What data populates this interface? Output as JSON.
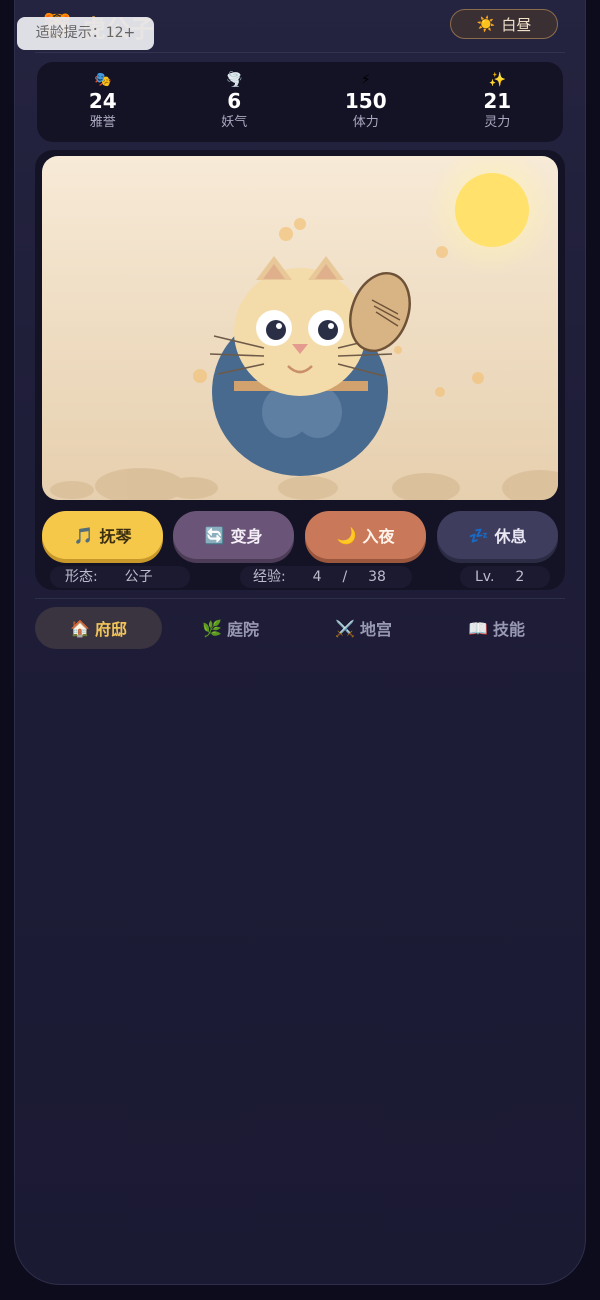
{
  "age_notice": "适龄提示：12+",
  "header": {
    "logo_icon": "🐯",
    "title": "虎公子",
    "time_toggle": {
      "icon": "☀️",
      "label": "白昼"
    }
  },
  "stats": [
    {
      "icon": "🎭",
      "value": "24",
      "label": "雅誉"
    },
    {
      "icon": "🌪️",
      "value": "6",
      "label": "妖气"
    },
    {
      "icon": "⚡",
      "value": "150",
      "label": "体力"
    },
    {
      "icon": "✨",
      "value": "21",
      "label": "灵力"
    }
  ],
  "actions": [
    {
      "icon": "🎵",
      "label": "抚琴"
    },
    {
      "icon": "🔄",
      "label": "变身"
    },
    {
      "icon": "🌙",
      "label": "入夜"
    },
    {
      "icon": "💤",
      "label": "休息"
    }
  ],
  "status": {
    "form_label": "形态:",
    "form_value": "公子",
    "exp_label": "经验:",
    "exp_current": "4",
    "exp_sep": "/",
    "exp_max": "38",
    "level_label": "Lv.",
    "level_value": "2"
  },
  "tabs": [
    {
      "icon": "🏠",
      "label": "府邸",
      "active": true
    },
    {
      "icon": "🌿",
      "label": "庭院",
      "active": false
    },
    {
      "icon": "⚔️",
      "label": "地宫",
      "active": false
    },
    {
      "icon": "📖",
      "label": "技能",
      "active": false
    }
  ],
  "colors": {
    "accent_gold": "#f0c35a",
    "background": "#1b1a33",
    "sun": "#ffe16b"
  }
}
